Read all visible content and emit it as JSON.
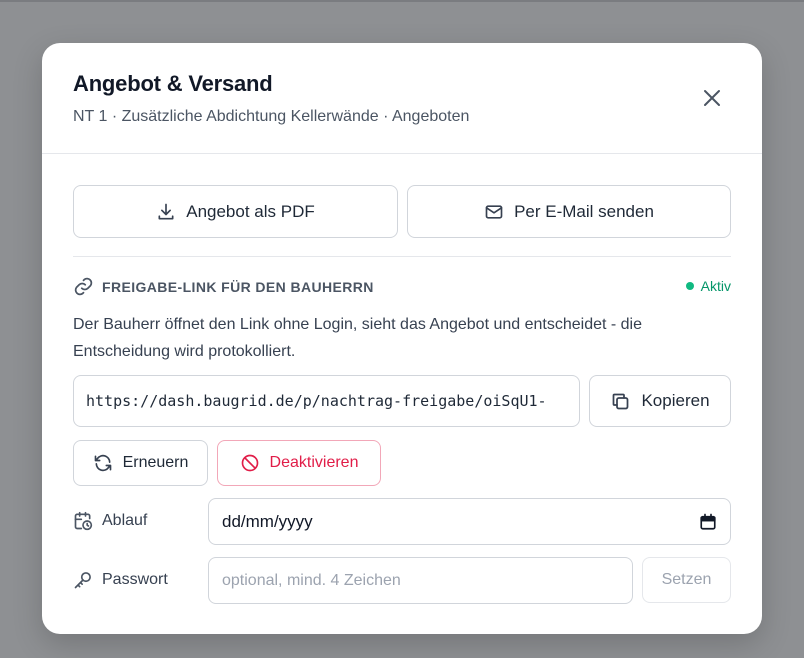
{
  "modal": {
    "title": "Angebot & Versand",
    "subtitle": "NT 1 · Zusätzliche Abdichtung Kellerwände · Angeboten"
  },
  "actions": {
    "pdf_label": "Angebot als PDF",
    "email_label": "Per E-Mail senden"
  },
  "share": {
    "heading": "FREIGABE-LINK FÜR DEN BAUHERRN",
    "status": "Aktiv",
    "status_color": "#10b981",
    "description": "Der Bauherr öffnet den Link ohne Login, sieht das Angebot und entscheidet - die Entscheidung wird protokolliert.",
    "url": "https://dash.baugrid.de/p/nachtrag-freigabe/oiSqU1-",
    "copy_label": "Kopieren",
    "renew_label": "Erneuern",
    "deactivate_label": "Deaktivieren",
    "danger_color": "#e11d48"
  },
  "expiry": {
    "label": "Ablauf",
    "value": "dd/mm/yyyy"
  },
  "password": {
    "label": "Passwort",
    "placeholder": "optional, mind. 4 Zeichen",
    "set_label": "Setzen"
  },
  "icons": [
    "close-icon",
    "download-icon",
    "mail-icon",
    "link-icon",
    "copy-icon",
    "refresh-icon",
    "ban-icon",
    "calendar-clock-icon",
    "calendar-icon",
    "key-icon"
  ]
}
